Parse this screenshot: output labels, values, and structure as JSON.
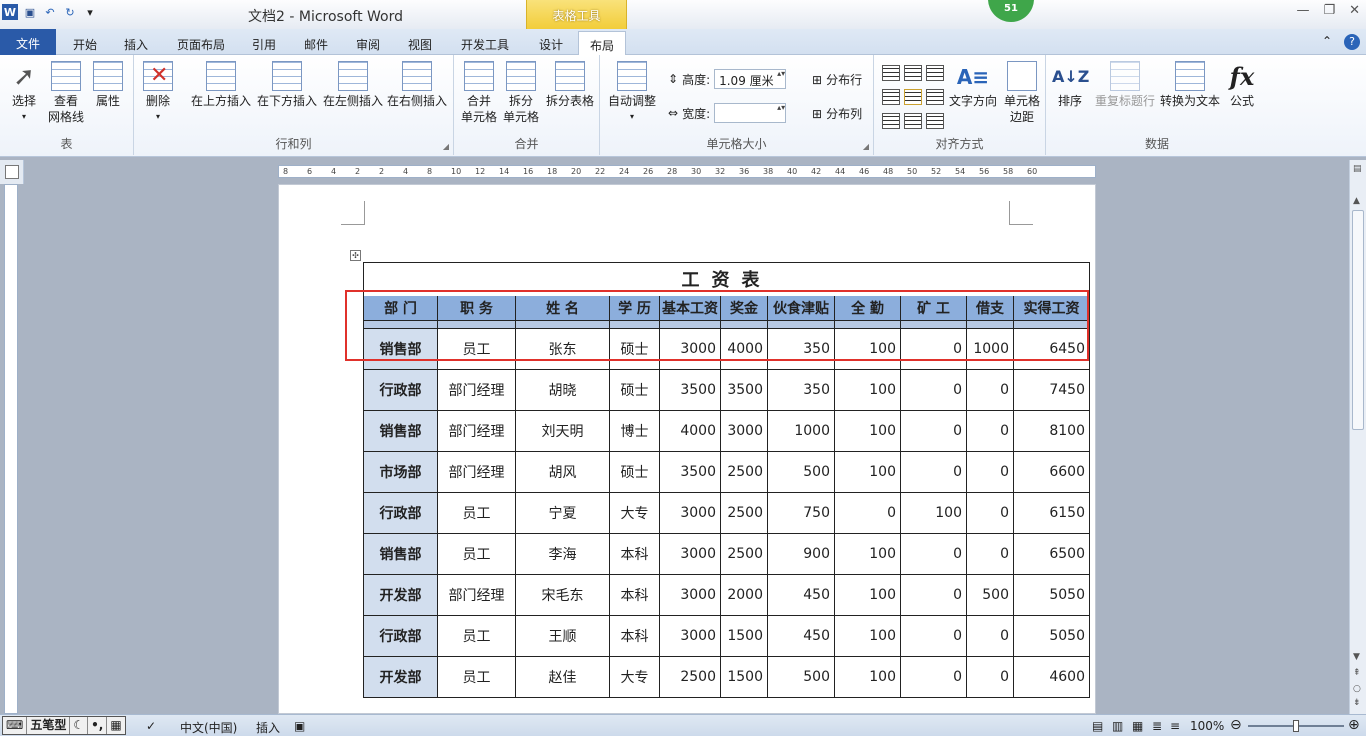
{
  "app": {
    "title": "文档2 - Microsoft Word",
    "context_tab_group": "表格工具",
    "notification_badge": "51"
  },
  "tabs": [
    "文件",
    "开始",
    "插入",
    "页面布局",
    "引用",
    "邮件",
    "审阅",
    "视图",
    "开发工具",
    "设计",
    "布局"
  ],
  "active_tab": "布局",
  "ribbon": {
    "groups": {
      "table": "表",
      "rows_cols": "行和列",
      "merge": "合并",
      "cell_size": "单元格大小",
      "alignment": "对齐方式",
      "data": "数据"
    },
    "buttons": {
      "select": "选择",
      "view_gridlines_1": "查看",
      "view_gridlines_2": "网格线",
      "properties": "属性",
      "delete": "删除",
      "insert_above": "在上方插入",
      "insert_below": "在下方插入",
      "insert_left": "在左侧插入",
      "insert_right": "在右侧插入",
      "merge_cells_1": "合并",
      "merge_cells_2": "单元格",
      "split_cells_1": "拆分",
      "split_cells_2": "单元格",
      "split_table": "拆分表格",
      "autofit": "自动调整",
      "height_label": "高度:",
      "height_value": "1.09 厘米",
      "width_label": "宽度:",
      "width_value": "",
      "distribute_rows": "分布行",
      "distribute_cols": "分布列",
      "text_direction": "文字方向",
      "cell_margins_1": "单元格",
      "cell_margins_2": "边距",
      "sort": "排序",
      "repeat_header": "重复标题行",
      "convert_to_text": "转换为文本",
      "formula": "公式",
      "formula_icon": "fx"
    }
  },
  "ruler_ticks": [
    "8",
    "6",
    "4",
    "2",
    "2",
    "4",
    "8",
    "10",
    "12",
    "14",
    "16",
    "18",
    "20",
    "22",
    "24",
    "26",
    "28",
    "30",
    "32",
    "36",
    "38",
    "40",
    "42",
    "44",
    "46",
    "48",
    "50",
    "52",
    "54",
    "56",
    "58",
    "60"
  ],
  "document": {
    "table_title": "工资表",
    "headers": [
      "部 门",
      "职 务",
      "姓 名",
      "学 历",
      "基本工资",
      "奖金",
      "伙食津贴",
      "全 勤",
      "矿 工",
      "借支",
      "实得工资"
    ],
    "rows": [
      [
        "销售部",
        "员工",
        "张东",
        "硕士",
        "3000",
        "4000",
        "350",
        "100",
        "0",
        "1000",
        "6450"
      ],
      [
        "行政部",
        "部门经理",
        "胡晓",
        "硕士",
        "3500",
        "3500",
        "350",
        "100",
        "0",
        "0",
        "7450"
      ],
      [
        "销售部",
        "部门经理",
        "刘天明",
        "博士",
        "4000",
        "3000",
        "1000",
        "100",
        "0",
        "0",
        "8100"
      ],
      [
        "市场部",
        "部门经理",
        "胡风",
        "硕士",
        "3500",
        "2500",
        "500",
        "100",
        "0",
        "0",
        "6600"
      ],
      [
        "行政部",
        "员工",
        "宁夏",
        "大专",
        "3000",
        "2500",
        "750",
        "0",
        "100",
        "0",
        "6150"
      ],
      [
        "销售部",
        "员工",
        "李海",
        "本科",
        "3000",
        "2500",
        "900",
        "100",
        "0",
        "0",
        "6500"
      ],
      [
        "开发部",
        "部门经理",
        "宋毛东",
        "本科",
        "3000",
        "2000",
        "450",
        "100",
        "0",
        "500",
        "5050"
      ],
      [
        "行政部",
        "员工",
        "王顺",
        "本科",
        "3000",
        "1500",
        "450",
        "100",
        "0",
        "0",
        "5050"
      ],
      [
        "开发部",
        "员工",
        "赵佳",
        "大专",
        "2500",
        "1500",
        "500",
        "100",
        "0",
        "0",
        "4600"
      ]
    ]
  },
  "status": {
    "ime": [
      "五笔型"
    ],
    "language": "中文(中国)",
    "insert_mode": "插入",
    "zoom": "100%"
  }
}
